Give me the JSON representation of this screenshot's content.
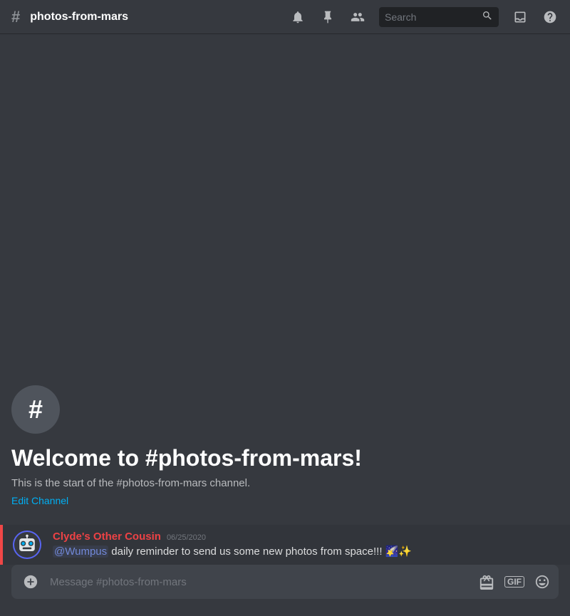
{
  "header": {
    "channel_hash": "#",
    "channel_name": "photos-from-mars",
    "search_placeholder": "Search"
  },
  "welcome": {
    "icon_text": "#",
    "title": "Welcome to #photos-from-mars!",
    "subtitle": "This is the start of the #photos-from-mars channel.",
    "edit_link": "Edit Channel"
  },
  "messages": [
    {
      "author": "Clyde's Other Cousin",
      "timestamp": "06/25/2020",
      "mention": "@Wumpus",
      "text_before": "",
      "text_after": " daily reminder to send us some new photos from space!!! 🌠✨"
    }
  ],
  "input": {
    "placeholder": "Message #photos-from-mars"
  },
  "icons": {
    "bell": "🔔",
    "pin": "📌",
    "members": "👤",
    "inbox": "📥",
    "help": "❓"
  }
}
